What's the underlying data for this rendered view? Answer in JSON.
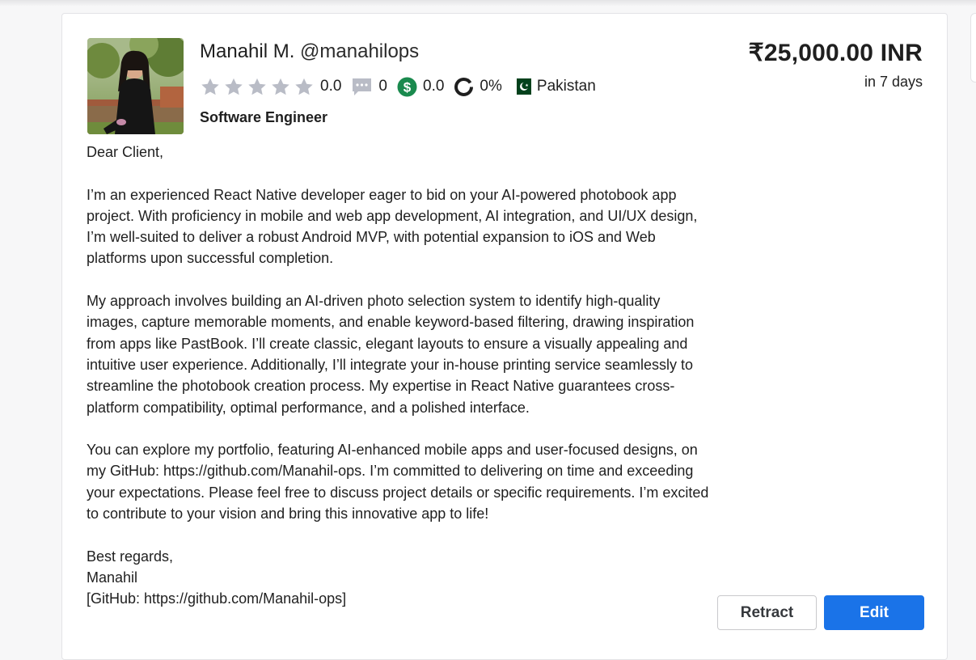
{
  "bid": {
    "name": "Manahil M.",
    "handle": "@manahilops",
    "rating": "0.0",
    "rating_stars_filled": 0,
    "reviews": "0",
    "earnings": "0.0",
    "completion": "0%",
    "country": "Pakistan",
    "title": "Software Engineer",
    "price": "₹25,000.00 INR",
    "delivery": "in 7 days",
    "proposal": [
      "Dear Client,",
      "I’m an experienced React Native developer eager to bid on your AI-powered photobook app project. With proficiency in mobile and web app development, AI integration, and UI/UX design, I’m well-suited to deliver a robust Android MVP, with potential expansion to iOS and Web platforms upon successful completion.",
      "My approach involves building an AI-driven photo selection system to identify high-quality images, capture memorable moments, and enable keyword-based filtering, drawing inspiration from apps like PastBook. I’ll create classic, elegant layouts to ensure a visually appealing and intuitive user experience. Additionally, I’ll integrate your in-house printing service seamlessly to streamline the photobook creation process. My expertise in React Native guarantees cross-platform compatibility, optimal performance, and a polished interface.",
      "You can explore my portfolio, featuring AI-enhanced mobile apps and user-focused designs, on my GitHub: https://github.com/Manahil-ops. I’m committed to delivering on time and exceeding your expectations. Please feel free to discuss project details or specific requirements. I’m excited to contribute to your vision and bring this innovative app to life!",
      "Best regards,",
      "Manahil",
      "[GitHub: https://github.com/Manahil-ops]"
    ]
  },
  "actions": {
    "retract_label": "Retract",
    "edit_label": "Edit"
  },
  "icons": {
    "star": "star-icon",
    "reviews": "comment-icon",
    "earnings": "dollar-icon",
    "completion": "ring-progress-icon",
    "flag": "pakistan-flag-icon"
  },
  "colors": {
    "star_empty": "#b9bcc6",
    "earnings_green": "#1a8a4e",
    "edit_blue": "#1a73e8",
    "flag_green": "#01411c"
  }
}
